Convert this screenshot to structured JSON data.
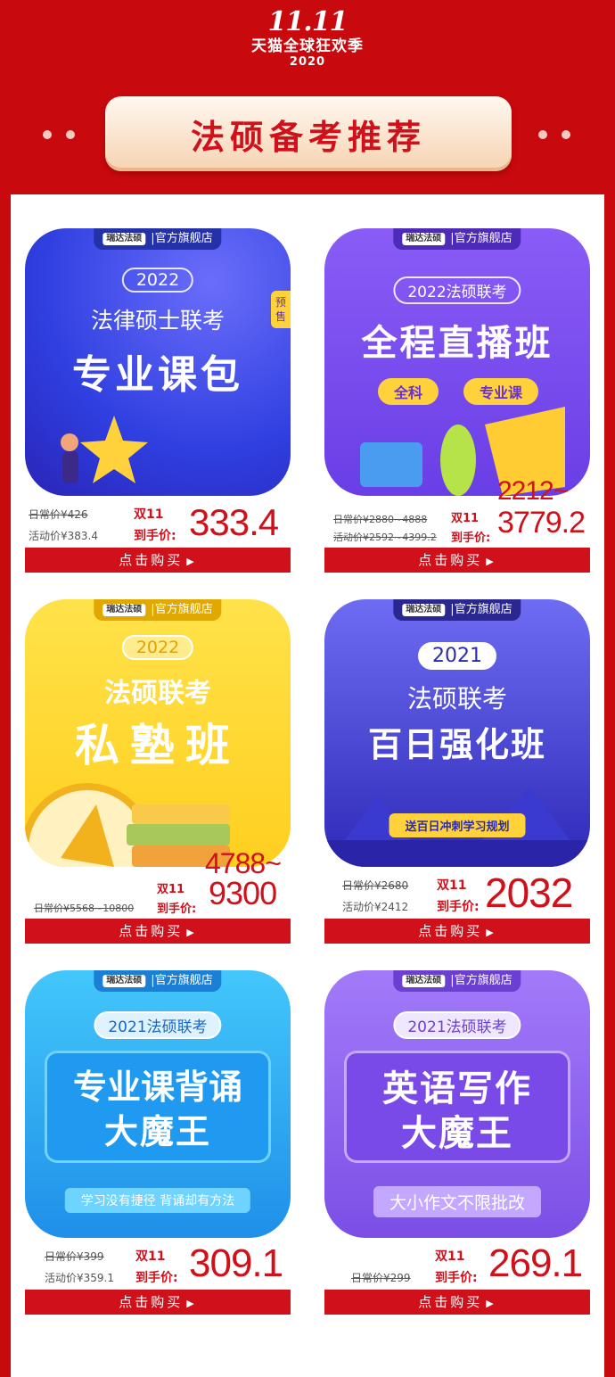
{
  "header": {
    "logo_mark": "11.11",
    "logo_text": "天猫全球狂欢季",
    "logo_year": "2020",
    "banner_title": "法硕备考推荐"
  },
  "store_brand": "瑞达法硕",
  "store_label": "官方旗舰店",
  "buy_label": "点击购买",
  "buy_arrow": "▶",
  "colors": {
    "page_bg": "#c8090d",
    "price_red": "#d0101a",
    "banner_text": "#d0101a"
  },
  "products": [
    {
      "year": "2022",
      "subtitle": "法律硕士联考",
      "title": "专业课包",
      "presale": "预售",
      "orig_label": "日常价",
      "orig_price": "¥426",
      "activity_label": "活动价",
      "activity_price": "¥383.4",
      "double11": "双11",
      "final_label": "到手价:",
      "final_price": "333.4"
    },
    {
      "year_tag": "2022法硕联考",
      "title": "全程直播班",
      "chips": [
        "全科",
        "专业课"
      ],
      "orig_label": "日常价",
      "orig_price": "¥2880~4888",
      "activity_label": "活动价",
      "activity_price": "¥2592~4399.2",
      "double11": "双11",
      "final_label": "到手价:",
      "final_price_1": "2212~",
      "final_price_2": "3779.2"
    },
    {
      "year": "2022",
      "subtitle": "法硕联考",
      "title": "私塾班",
      "orig_label": "日常价",
      "orig_price": "¥5568~10800",
      "double11": "双11",
      "final_label": "到手价:",
      "final_price_1": "4788~",
      "final_price_2": "9300"
    },
    {
      "year": "2021",
      "subtitle": "法硕联考",
      "title": "百日强化班",
      "banner": "送百日冲刺学习规划",
      "orig_label": "日常价",
      "orig_price": "¥2680",
      "activity_label": "活动价",
      "activity_price": "¥2412",
      "double11": "双11",
      "final_label": "到手价:",
      "final_price": "2032"
    },
    {
      "year_tag": "2021法硕联考",
      "title_line1": "专业课背诵",
      "title_line2": "大魔王",
      "banner": "学习没有捷径  背诵却有方法",
      "orig_label": "日常价",
      "orig_price": "¥399",
      "activity_label": "活动价",
      "activity_price": "¥359.1",
      "double11": "双11",
      "final_label": "到手价:",
      "final_price": "309.1"
    },
    {
      "year_tag": "2021法硕联考",
      "title_line1": "英语写作",
      "title_line2": "大魔王",
      "banner": "大小作文不限批改",
      "orig_label": "日常价",
      "orig_price": "¥299",
      "double11": "双11",
      "final_label": "到手价:",
      "final_price": "269.1"
    }
  ]
}
